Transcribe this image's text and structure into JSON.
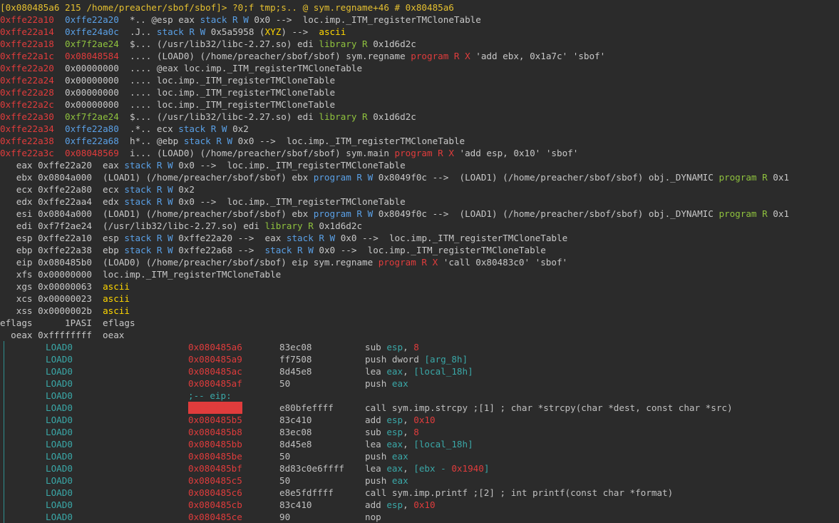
{
  "prompt": "[0x080485a6 215 /home/preacher/sbof/sbof]> ?0;f tmp;s.. @ sym.regname+46 # 0x80485a6",
  "stack_rows": [
    {
      "a": "0xffe22a10",
      "v": "0xffe22a20",
      "vc": "blu",
      "rest": [
        [
          "  *.. @esp eax ",
          "wht"
        ],
        [
          "stack R W",
          "blu"
        ],
        [
          " 0x0 -->  loc.imp._ITM_registerTMCloneTable",
          "wht"
        ]
      ]
    },
    {
      "a": "0xffe22a14",
      "v": "0xffe24a0c",
      "vc": "blu",
      "rest": [
        [
          "  .J.. ",
          "wht"
        ],
        [
          "stack R W",
          "blu"
        ],
        [
          " 0x5a5958 (",
          "wht"
        ],
        [
          "XYZ",
          "ylw"
        ],
        [
          ") -->  ",
          "wht"
        ],
        [
          "ascii",
          "ylw"
        ]
      ]
    },
    {
      "a": "0xffe22a18",
      "v": "0xf7f2ae24",
      "vc": "grn",
      "rest": [
        [
          "  $... (/usr/lib32/libc-2.27.so) edi ",
          "wht"
        ],
        [
          "library R",
          "grn"
        ],
        [
          " 0x1d6d2c",
          "wht"
        ]
      ]
    },
    {
      "a": "0xffe22a1c",
      "v": "0x08048584",
      "vc": "red",
      "rest": [
        [
          "  .... (LOAD0) (/home/preacher/sbof/sbof) sym.regname ",
          "wht"
        ],
        [
          "program R X",
          "red"
        ],
        [
          " 'add ebx, 0x1a7c' 'sbof'",
          "wht"
        ]
      ]
    },
    {
      "a": "0xffe22a20",
      "v": "0x00000000",
      "vc": "wht",
      "rest": [
        [
          "  .... @eax loc.imp._ITM_registerTMCloneTable",
          "wht"
        ]
      ]
    },
    {
      "a": "0xffe22a24",
      "v": "0x00000000",
      "vc": "wht",
      "rest": [
        [
          "  .... loc.imp._ITM_registerTMCloneTable",
          "wht"
        ]
      ]
    },
    {
      "a": "0xffe22a28",
      "v": "0x00000000",
      "vc": "wht",
      "rest": [
        [
          "  .... loc.imp._ITM_registerTMCloneTable",
          "wht"
        ]
      ]
    },
    {
      "a": "0xffe22a2c",
      "v": "0x00000000",
      "vc": "wht",
      "rest": [
        [
          "  .... loc.imp._ITM_registerTMCloneTable",
          "wht"
        ]
      ]
    },
    {
      "a": "0xffe22a30",
      "v": "0xf7f2ae24",
      "vc": "grn",
      "rest": [
        [
          "  $... (/usr/lib32/libc-2.27.so) edi ",
          "wht"
        ],
        [
          "library R",
          "grn"
        ],
        [
          " 0x1d6d2c",
          "wht"
        ]
      ]
    },
    {
      "a": "0xffe22a34",
      "v": "0xffe22a80",
      "vc": "blu",
      "rest": [
        [
          "  .*.. ecx ",
          "wht"
        ],
        [
          "stack R W",
          "blu"
        ],
        [
          " 0x2",
          "wht"
        ]
      ]
    },
    {
      "a": "0xffe22a38",
      "v": "0xffe22a68",
      "vc": "blu",
      "rest": [
        [
          "  h*.. @ebp ",
          "wht"
        ],
        [
          "stack R W",
          "blu"
        ],
        [
          " 0x0 -->  loc.imp._ITM_registerTMCloneTable",
          "wht"
        ]
      ]
    },
    {
      "a": "0xffe22a3c",
      "v": "0x08048569",
      "vc": "red",
      "rest": [
        [
          "  i... (LOAD0) (/home/preacher/sbof/sbof) sym.main ",
          "wht"
        ],
        [
          "program R X",
          "red"
        ],
        [
          " 'add esp, 0x10' 'sbof'",
          "wht"
        ]
      ]
    }
  ],
  "reg_rows": [
    [
      [
        "   eax 0xffe22a20  eax ",
        "wht"
      ],
      [
        "stack R W",
        "blu"
      ],
      [
        " 0x0 -->  loc.imp._ITM_registerTMCloneTable",
        "wht"
      ]
    ],
    [
      [
        "   ebx 0x0804a000  (LOAD1) (/home/preacher/sbof/sbof) ebx ",
        "wht"
      ],
      [
        "program R W",
        "blu"
      ],
      [
        " 0x8049f0c -->  (LOAD1) (/home/preacher/sbof/sbof) obj._DYNAMIC ",
        "wht"
      ],
      [
        "program R",
        "grn"
      ],
      [
        " 0x1",
        "wht"
      ]
    ],
    [
      [
        "   ecx 0xffe22a80  ecx ",
        "wht"
      ],
      [
        "stack R W",
        "blu"
      ],
      [
        " 0x2",
        "wht"
      ]
    ],
    [
      [
        "   edx 0xffe22aa4  edx ",
        "wht"
      ],
      [
        "stack R W",
        "blu"
      ],
      [
        " 0x0 -->  loc.imp._ITM_registerTMCloneTable",
        "wht"
      ]
    ],
    [
      [
        "   esi 0x0804a000  (LOAD1) (/home/preacher/sbof/sbof) ebx ",
        "wht"
      ],
      [
        "program R W",
        "blu"
      ],
      [
        " 0x8049f0c -->  (LOAD1) (/home/preacher/sbof/sbof) obj._DYNAMIC ",
        "wht"
      ],
      [
        "program R",
        "grn"
      ],
      [
        " 0x1",
        "wht"
      ]
    ],
    [
      [
        "   edi 0xf7f2ae24  (/usr/lib32/libc-2.27.so) edi ",
        "wht"
      ],
      [
        "library R",
        "grn"
      ],
      [
        " 0x1d6d2c",
        "wht"
      ]
    ],
    [
      [
        "   esp 0xffe22a10  esp ",
        "wht"
      ],
      [
        "stack R W",
        "blu"
      ],
      [
        " 0xffe22a20 -->  eax ",
        "wht"
      ],
      [
        "stack R W",
        "blu"
      ],
      [
        " 0x0 -->  loc.imp._ITM_registerTMCloneTable",
        "wht"
      ]
    ],
    [
      [
        "   ebp 0xffe22a38  ebp ",
        "wht"
      ],
      [
        "stack R W",
        "blu"
      ],
      [
        " 0xffe22a68 -->  ",
        "wht"
      ],
      [
        "stack R W",
        "blu"
      ],
      [
        " 0x0 -->  loc.imp._ITM_registerTMCloneTable",
        "wht"
      ]
    ],
    [
      [
        "   eip 0x080485b0  (LOAD0) (/home/preacher/sbof/sbof) eip sym.regname ",
        "wht"
      ],
      [
        "program R X",
        "red"
      ],
      [
        " 'call 0x80483c0' 'sbof'",
        "wht"
      ]
    ],
    [
      [
        "   xfs 0x00000000  loc.imp._ITM_registerTMCloneTable",
        "wht"
      ]
    ],
    [
      [
        "   xgs 0x00000063  ",
        "wht"
      ],
      [
        "ascii",
        "ylw"
      ]
    ],
    [
      [
        "   xcs 0x00000023  ",
        "wht"
      ],
      [
        "ascii",
        "ylw"
      ]
    ],
    [
      [
        "   xss 0x0000002b  ",
        "wht"
      ],
      [
        "ascii",
        "ylw"
      ]
    ],
    [
      [
        "eflags      1PASI  eflags",
        "wht"
      ]
    ],
    [
      [
        "  oeax 0xffffffff  oeax",
        "wht"
      ]
    ]
  ],
  "disasm_rows": [
    {
      "seg": "LOAD0",
      "addr": "0x080485a6",
      "hex": "83ec08",
      "ins": [
        [
          "sub ",
          "w"
        ],
        [
          "esp",
          "c"
        ],
        [
          ", ",
          "w"
        ],
        [
          "8",
          "r"
        ]
      ]
    },
    {
      "seg": "LOAD0",
      "addr": "0x080485a9",
      "hex": "ff7508",
      "ins": [
        [
          "push dword ",
          "w"
        ],
        [
          "[arg_8h]",
          "c"
        ]
      ]
    },
    {
      "seg": "LOAD0",
      "addr": "0x080485ac",
      "hex": "8d45e8",
      "ins": [
        [
          "lea ",
          "w"
        ],
        [
          "eax",
          "c"
        ],
        [
          ", ",
          "w"
        ],
        [
          "[local_18h]",
          "c"
        ]
      ]
    },
    {
      "seg": "LOAD0",
      "addr": "0x080485af",
      "hex": "50",
      "ins": [
        [
          "push ",
          "w"
        ],
        [
          "eax",
          "c"
        ]
      ]
    },
    {
      "seg": "LOAD0",
      "eip": ";-- eip:"
    },
    {
      "seg": "LOAD0",
      "addr": "0x080485b0",
      "hl": true,
      "hex": "e80bfeffff",
      "ins": [
        [
          "call sym.imp.strcpy ;[1] ; char *strcpy(char *dest, const char *src)",
          "w"
        ]
      ]
    },
    {
      "seg": "LOAD0",
      "addr": "0x080485b5",
      "hex": "83c410",
      "ins": [
        [
          "add ",
          "w"
        ],
        [
          "esp",
          "c"
        ],
        [
          ", ",
          "w"
        ],
        [
          "0x10",
          "r"
        ]
      ]
    },
    {
      "seg": "LOAD0",
      "addr": "0x080485b8",
      "hex": "83ec08",
      "ins": [
        [
          "sub ",
          "w"
        ],
        [
          "esp",
          "c"
        ],
        [
          ", ",
          "w"
        ],
        [
          "8",
          "r"
        ]
      ]
    },
    {
      "seg": "LOAD0",
      "addr": "0x080485bb",
      "hex": "8d45e8",
      "ins": [
        [
          "lea ",
          "w"
        ],
        [
          "eax",
          "c"
        ],
        [
          ", ",
          "w"
        ],
        [
          "[local_18h]",
          "c"
        ]
      ]
    },
    {
      "seg": "LOAD0",
      "addr": "0x080485be",
      "hex": "50",
      "ins": [
        [
          "push ",
          "w"
        ],
        [
          "eax",
          "c"
        ]
      ]
    },
    {
      "seg": "LOAD0",
      "addr": "0x080485bf",
      "hex": "8d83c0e6ffff",
      "ins": [
        [
          "lea ",
          "w"
        ],
        [
          "eax",
          "c"
        ],
        [
          ", ",
          "w"
        ],
        [
          "[ebx - ",
          "c"
        ],
        [
          "0x1940",
          "r"
        ],
        [
          "]",
          "c"
        ]
      ]
    },
    {
      "seg": "LOAD0",
      "addr": "0x080485c5",
      "hex": "50",
      "ins": [
        [
          "push ",
          "w"
        ],
        [
          "eax",
          "c"
        ]
      ]
    },
    {
      "seg": "LOAD0",
      "addr": "0x080485c6",
      "hex": "e8e5fdffff",
      "ins": [
        [
          "call sym.imp.printf ;[2] ; int printf(const char *format)",
          "w"
        ]
      ]
    },
    {
      "seg": "LOAD0",
      "addr": "0x080485cb",
      "hex": "83c410",
      "ins": [
        [
          "add ",
          "w"
        ],
        [
          "esp",
          "c"
        ],
        [
          ", ",
          "w"
        ],
        [
          "0x10",
          "r"
        ]
      ]
    },
    {
      "seg": "LOAD0",
      "addr": "0x080485ce",
      "hex": "90",
      "ins": [
        [
          "nop",
          "w"
        ]
      ]
    }
  ]
}
